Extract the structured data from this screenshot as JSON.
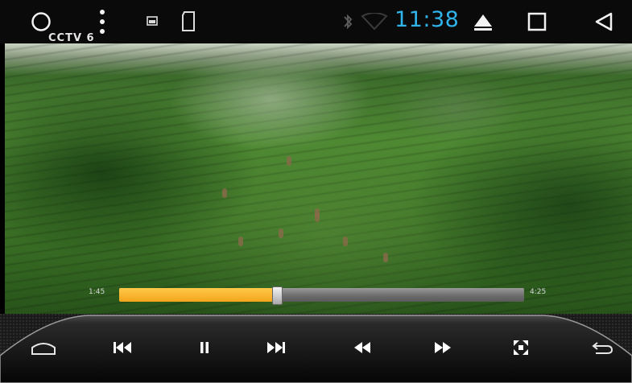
{
  "status_bar": {
    "time": "11:38",
    "accent_color": "#2fb3ea",
    "icons": [
      "circle-menu-icon",
      "more-vert-icon",
      "screen-icon",
      "sd-card-icon",
      "bluetooth-icon",
      "wifi-icon",
      "eject-icon",
      "recents-icon",
      "back-nav-icon"
    ]
  },
  "video": {
    "channel_logo": "CCTV 6",
    "progress": {
      "current_time": "1:45",
      "total_time": "4:25",
      "fraction": 0.39,
      "fill_color": "#f3a51b"
    }
  },
  "controls": {
    "buttons": [
      "home",
      "previous",
      "pause",
      "next",
      "rewind",
      "fast-forward",
      "fullscreen",
      "return"
    ]
  }
}
